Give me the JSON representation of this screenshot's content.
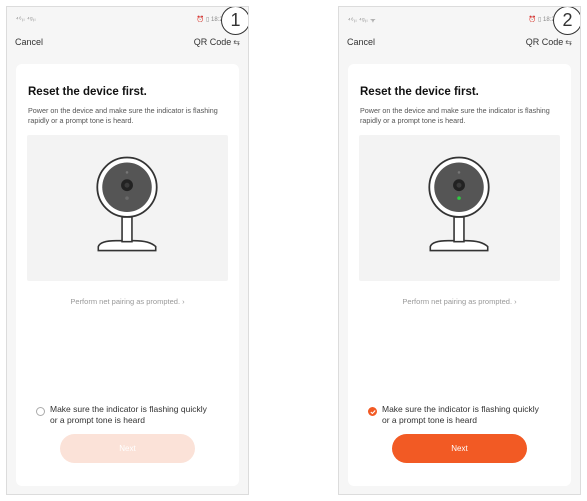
{
  "steps": [
    {
      "step_number": "1",
      "status_signal": "⁴⁶ᵢₗ ⁴ᵍᵢₗ",
      "status_system": "⏰ ▯ 18:26",
      "nav": {
        "cancel": "Cancel",
        "qr_code": "QR Code",
        "swap_icon": "⇆"
      },
      "title": "Reset the device first.",
      "description": "Power on the device and make sure the indicator is flashing rapidly or a prompt tone is heard.",
      "link": "Perform net pairing as prompted. ›",
      "confirm_text": "Make sure the indicator is flashing quickly or a prompt tone is heard",
      "checked": false,
      "next_label": "Next",
      "next_enabled": false,
      "indicator_color": "#6b6b6b"
    },
    {
      "step_number": "2",
      "status_signal": "⁴⁶ᵢₗ ⁴ᵍᵢₗ ᯤ",
      "status_system": "⏰ ▯ 18:26",
      "nav": {
        "cancel": "Cancel",
        "qr_code": "QR Code",
        "swap_icon": "⇆"
      },
      "title": "Reset the device first.",
      "description": "Power on the device and make sure the indicator is flashing rapidly or a prompt tone is heard.",
      "link": "Perform net pairing as prompted. ›",
      "confirm_text": "Make sure the indicator is flashing quickly or a prompt tone is heard",
      "checked": true,
      "next_label": "Next",
      "next_enabled": true,
      "indicator_color": "#2ecc40"
    }
  ],
  "colors": {
    "accent": "#f25a24",
    "accent_disabled": "#fbe2d8",
    "page_bg": "#f6f6f6"
  }
}
